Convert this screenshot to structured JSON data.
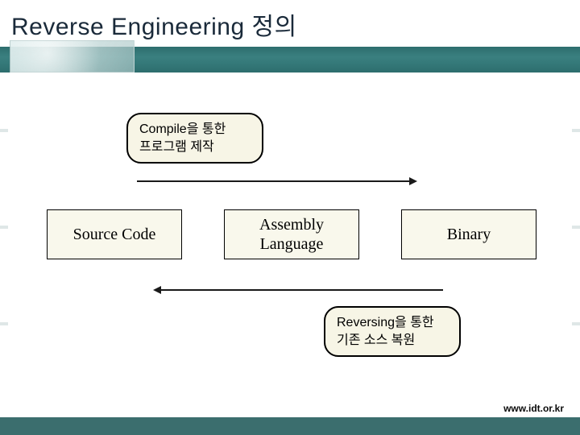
{
  "title": "Reverse Engineering 정의",
  "note_compile": "Compile을 통한\n프로그램 제작",
  "note_reverse": "Reversing을 통한 기존 소스 복원",
  "nodes": {
    "source": "Source Code",
    "assembly": "Assembly\nLanguage",
    "binary": "Binary"
  },
  "footer_url": "www.idt.or.kr"
}
